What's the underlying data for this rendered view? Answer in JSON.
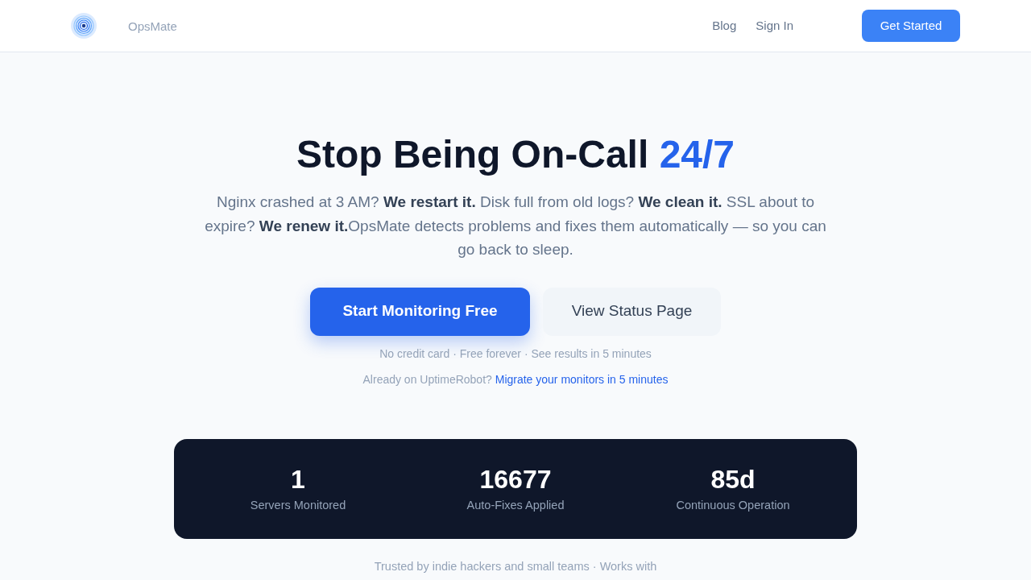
{
  "header": {
    "brand": "OpsMate",
    "links": [
      "Blog",
      "Sign In"
    ],
    "cta": "Get Started"
  },
  "hero": {
    "title": "Stop Being On-Call",
    "title_highlight": "24/7",
    "description": "Nginx crashed at 3 AM? **We restart it.** Disk full from old logs? **We clean it.** SSL about to expire? **We renew it.**OpsMate detects problems and fixes them automatically — so you can go back to sleep.",
    "buttons": [
      {
        "label": "Start Monitoring Free",
        "kind": "primary"
      },
      {
        "label": "View Status Page",
        "kind": "secondary"
      }
    ],
    "note": "No credit card · Free forever · See results in 5 minutes",
    "migrate": {
      "text": "Already on UptimeRobot?",
      "link": "Migrate your monitors in 5 minutes"
    }
  },
  "stats": [
    {
      "value": "1",
      "label": "Servers Monitored"
    },
    {
      "value": "16677",
      "label": "Auto-Fixes Applied"
    },
    {
      "value": "85d",
      "label": "Continuous Operation"
    }
  ],
  "trust_line": "Trusted by indie hackers and small teams · Works with"
}
